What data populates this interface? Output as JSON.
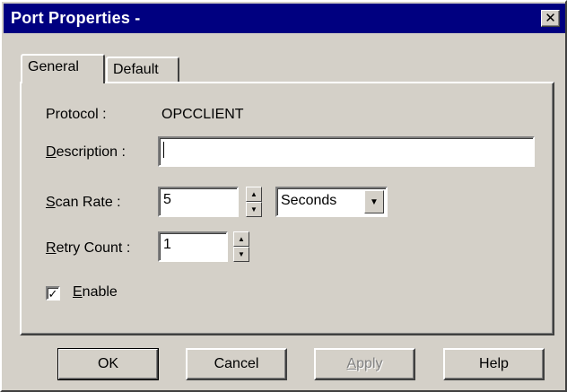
{
  "window": {
    "title": "Port Properties -",
    "close_glyph": "✕"
  },
  "tabs": [
    {
      "label": "General",
      "selected": true
    },
    {
      "label": "Default",
      "selected": false
    }
  ],
  "form": {
    "protocol_label": "Protocol :",
    "protocol_value": "OPCCLIENT",
    "description_label_access": "D",
    "description_label_rest": "escription :",
    "description_value": "",
    "scan_rate_label_access": "S",
    "scan_rate_label_rest": "can Rate :",
    "scan_rate_value": "5",
    "scan_rate_unit": "Seconds",
    "retry_label_access": "R",
    "retry_label_rest": "etry Count :",
    "retry_value": "1",
    "enable_label_access": "E",
    "enable_label_rest": "nable",
    "enable_checked": true
  },
  "buttons": {
    "ok": "OK",
    "cancel": "Cancel",
    "apply_access": "A",
    "apply_rest": "pply",
    "help": "Help"
  },
  "colors": {
    "titlebar": "#000080",
    "face": "#d4d0c8"
  }
}
